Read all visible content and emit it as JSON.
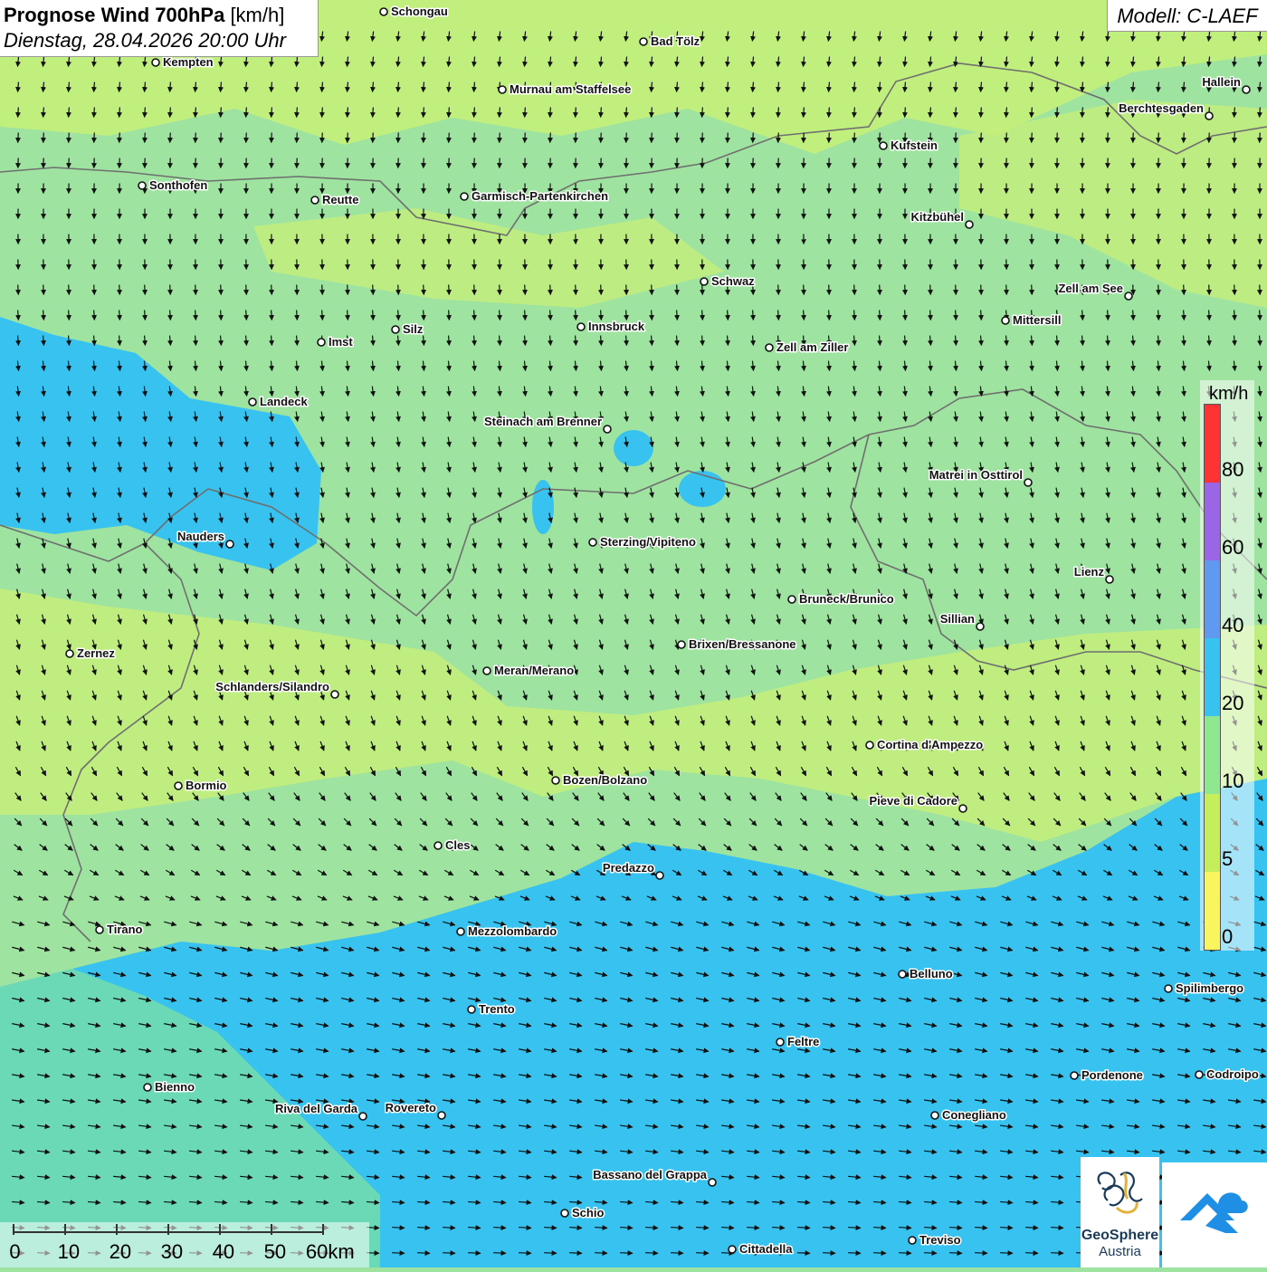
{
  "title": {
    "main": "Prognose Wind 700hPa",
    "unit": "[km/h]",
    "datetime": "Dienstag, 28.04.2026 20:00 Uhr"
  },
  "model": "Modell: C-LAEF",
  "legend": {
    "unit": "km/h",
    "labels": [
      "80",
      "60",
      "40",
      "20",
      "10",
      "5",
      "0"
    ],
    "colors": [
      "#ff3333",
      "#9b66e6",
      "#5f9af0",
      "#37c2f0",
      "#8fe88f",
      "#c4ef5a",
      "#f8f55e"
    ]
  },
  "scale_bar": {
    "labels": [
      "0",
      "10",
      "20",
      "30",
      "40",
      "50",
      "60km"
    ]
  },
  "logo": {
    "name": "GeoSphere",
    "sub": "Austria"
  },
  "cities": [
    {
      "name": "Schongau",
      "label_side": "right"
    },
    {
      "name": "Bad Tölz",
      "label_side": "right"
    },
    {
      "name": "Kempten",
      "label_side": "right"
    },
    {
      "name": "Murnau am Staffelsee",
      "label_side": "right"
    },
    {
      "name": "Hallein",
      "label_side": "left"
    },
    {
      "name": "Berchtesgaden",
      "label_side": "left"
    },
    {
      "name": "Kufstein",
      "label_side": "right"
    },
    {
      "name": "Sonthofen",
      "label_side": "right"
    },
    {
      "name": "Reutte",
      "label_side": "right"
    },
    {
      "name": "Garmisch-Partenkirchen",
      "label_side": "right"
    },
    {
      "name": "Kitzbühel",
      "label_side": "left"
    },
    {
      "name": "Schwaz",
      "label_side": "right"
    },
    {
      "name": "Zell am See",
      "label_side": "left"
    },
    {
      "name": "Silz",
      "label_side": "right"
    },
    {
      "name": "Innsbruck",
      "label_side": "right"
    },
    {
      "name": "Imst",
      "label_side": "right"
    },
    {
      "name": "Mittersill",
      "label_side": "right"
    },
    {
      "name": "Zell am Ziller",
      "label_side": "right"
    },
    {
      "name": "Landeck",
      "label_side": "right"
    },
    {
      "name": "Steinach am Brenner",
      "label_side": "left"
    },
    {
      "name": "Matrei in Osttirol",
      "label_side": "left"
    },
    {
      "name": "Nauders",
      "label_side": "left"
    },
    {
      "name": "Sterzing/Vipiteno",
      "label_side": "right"
    },
    {
      "name": "Lienz",
      "label_side": "left"
    },
    {
      "name": "Bruneck/Brunico",
      "label_side": "right"
    },
    {
      "name": "Sillian",
      "label_side": "left"
    },
    {
      "name": "Brixen/Bressanone",
      "label_side": "right"
    },
    {
      "name": "Zernez",
      "label_side": "right"
    },
    {
      "name": "Meran/Merano",
      "label_side": "right"
    },
    {
      "name": "Schlanders/Silandro",
      "label_side": "left"
    },
    {
      "name": "Cortina d'Ampezzo",
      "label_side": "right"
    },
    {
      "name": "Bozen/Bolzano",
      "label_side": "right"
    },
    {
      "name": "Bormio",
      "label_side": "right"
    },
    {
      "name": "Pieve di Cadore",
      "label_side": "left"
    },
    {
      "name": "Cles",
      "label_side": "right"
    },
    {
      "name": "Predazzo",
      "label_side": "left"
    },
    {
      "name": "Tirano",
      "label_side": "right"
    },
    {
      "name": "Mezzolombardo",
      "label_side": "right"
    },
    {
      "name": "Belluno",
      "label_side": "right"
    },
    {
      "name": "Spilimbergo",
      "label_side": "right"
    },
    {
      "name": "Trento",
      "label_side": "right"
    },
    {
      "name": "Feltre",
      "label_side": "right"
    },
    {
      "name": "Pordenone",
      "label_side": "right"
    },
    {
      "name": "Codroipo",
      "label_side": "right"
    },
    {
      "name": "Bienno",
      "label_side": "right"
    },
    {
      "name": "Riva del Garda",
      "label_side": "left"
    },
    {
      "name": "Rovereto",
      "label_side": "left"
    },
    {
      "name": "Conegliano",
      "label_side": "right"
    },
    {
      "name": "Bassano del Grappa",
      "label_side": "left"
    },
    {
      "name": "Schio",
      "label_side": "right"
    },
    {
      "name": "Treviso",
      "label_side": "right"
    },
    {
      "name": "Cittadella",
      "label_side": "right"
    }
  ]
}
